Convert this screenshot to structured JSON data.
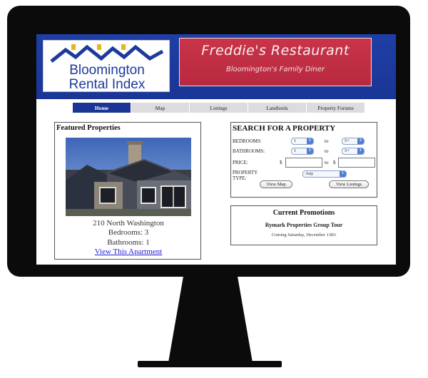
{
  "header": {
    "logo_line1": "Bloomington",
    "logo_line2": "Rental Index",
    "ad_title": "Freddie's Restaurant",
    "ad_subtitle": "Bloomington's Family Diner"
  },
  "nav": {
    "items": [
      {
        "label": "Home",
        "active": true
      },
      {
        "label": "Map",
        "active": false
      },
      {
        "label": "Listings",
        "active": false
      },
      {
        "label": "Landlords",
        "active": false
      },
      {
        "label": "Property Forums",
        "active": false
      }
    ]
  },
  "featured": {
    "title": "Featured Properties",
    "address": "210 North Washington",
    "bedrooms": "Bedrooms: 3",
    "bathrooms": "Bathrooms: 1",
    "link": "View This Apartment"
  },
  "search": {
    "title": "SEARCH FOR A PROPERTY",
    "bedrooms_label": "BEDROOMS:",
    "bathrooms_label": "BATHROOMS:",
    "price_label": "PRICE:",
    "type_label_1": "PROPERTY",
    "type_label_2": "TYPE:",
    "to": "to",
    "dollar": "$",
    "bed_from": "1",
    "bed_to": "5+",
    "bath_from": "1",
    "bath_to": "5+",
    "type_value": "Any",
    "view_map": "View Map",
    "view_listings": "View Listings"
  },
  "promotions": {
    "title": "Current Promotions",
    "name": "Rymark Properties Group Tour",
    "date": "Coming Saturday, December 13th!"
  },
  "colors": {
    "header_blue": "#1a3595",
    "ad_red": "#c93449",
    "link_blue": "#1a1ad6"
  }
}
